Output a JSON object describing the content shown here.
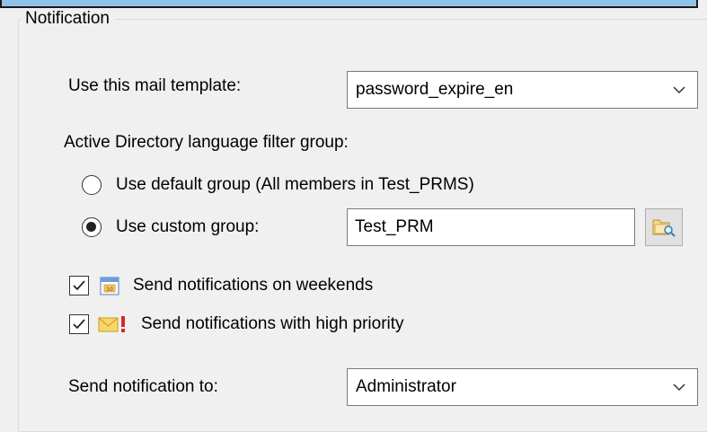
{
  "groupbox": {
    "title": "Notification"
  },
  "template": {
    "label": "Use this mail template:",
    "selected": "password_expire_en"
  },
  "language_filter": {
    "heading": "Active Directory language filter group:",
    "default_option": {
      "label": "Use default group (All members in Test_PRMS)",
      "selected": false
    },
    "custom_option": {
      "label": "Use custom group:",
      "selected": true
    },
    "custom_group_value": "Test_PRM"
  },
  "weekends": {
    "label": "Send notifications on weekends",
    "checked": true,
    "icon": "calendar-icon"
  },
  "high_priority": {
    "label": "Send notifications with high priority",
    "checked": true,
    "icon": "envelope-exclamation-icon"
  },
  "recipient": {
    "label": "Send notification to:",
    "selected": "Administrator"
  },
  "colors": {
    "accent_bar": "#8fc3e8",
    "background": "#f0f0f0",
    "field_border": "#7a7a7a"
  }
}
